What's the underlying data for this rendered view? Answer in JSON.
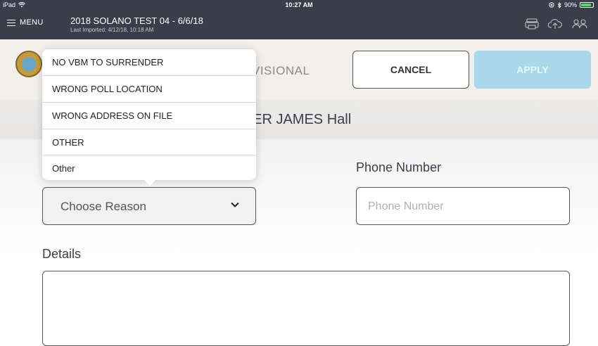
{
  "status_bar": {
    "device": "iPad",
    "time": "10:27 AM",
    "battery": "90%",
    "battery_level": 0.9,
    "battery_color": "#4cd964"
  },
  "nav": {
    "menu_label": "MENU",
    "election_title": "2018 SOLANO TEST 04 - 6/6/18",
    "last_imported": "Last Imported: 4/12/18, 10:18 AM",
    "icons": [
      "printer-icon",
      "cloud-upload-icon",
      "users-icon"
    ]
  },
  "header": {
    "title_partial": "VISIONAL",
    "cancel_label": "CANCEL",
    "apply_label": "APPLY",
    "apply_color": "#a9d8ea"
  },
  "voter": {
    "name_partial": "LER JAMES Hall"
  },
  "form": {
    "reason_placeholder": "Choose Reason",
    "phone_label": "Phone Number",
    "phone_placeholder": "Phone Number",
    "details_label": "Details"
  },
  "reason_options": [
    "NO VBM TO SURRENDER",
    "WRONG POLL LOCATION",
    "WRONG ADDRESS ON FILE",
    "OTHER",
    "Other"
  ],
  "colors": {
    "nav_bg": "#3a3d4a",
    "header_bg": "#f3efeb"
  }
}
